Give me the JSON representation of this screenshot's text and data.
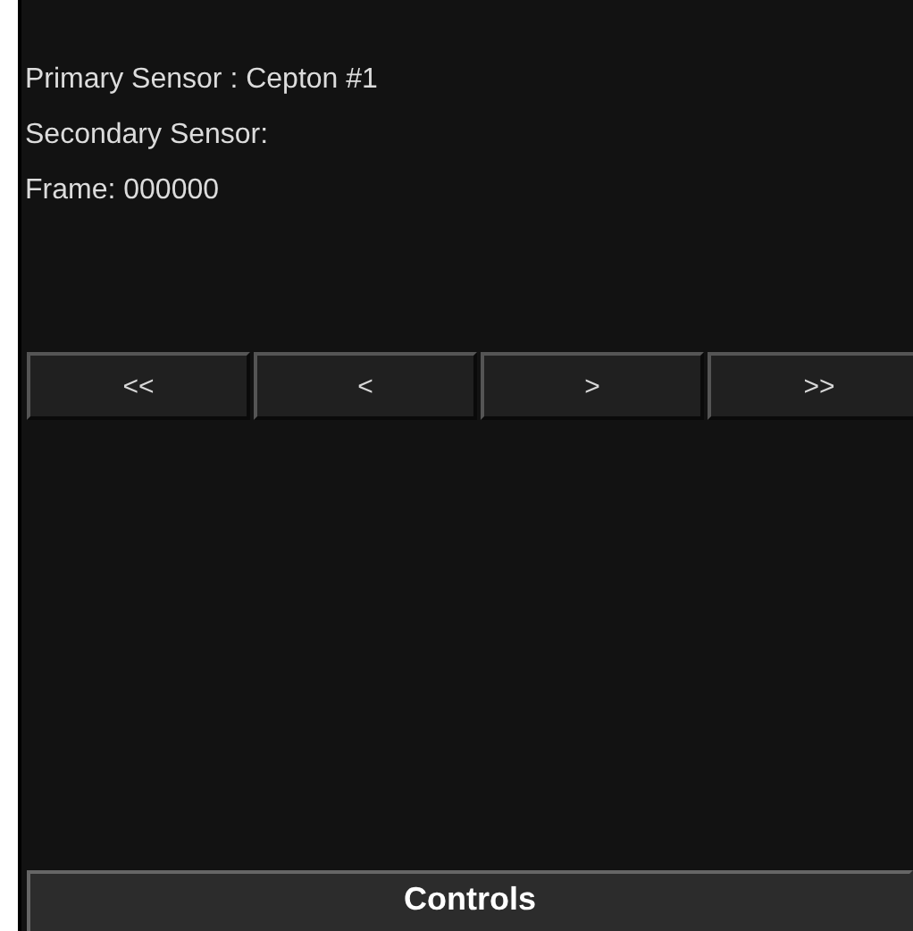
{
  "info": [
    "Primary Sensor : Cepton #1",
    "Secondary Sensor:",
    "Frame: 000000"
  ],
  "nav_buttons": [
    "<<",
    "<",
    ">",
    ">>"
  ],
  "footer_button": "Controls"
}
